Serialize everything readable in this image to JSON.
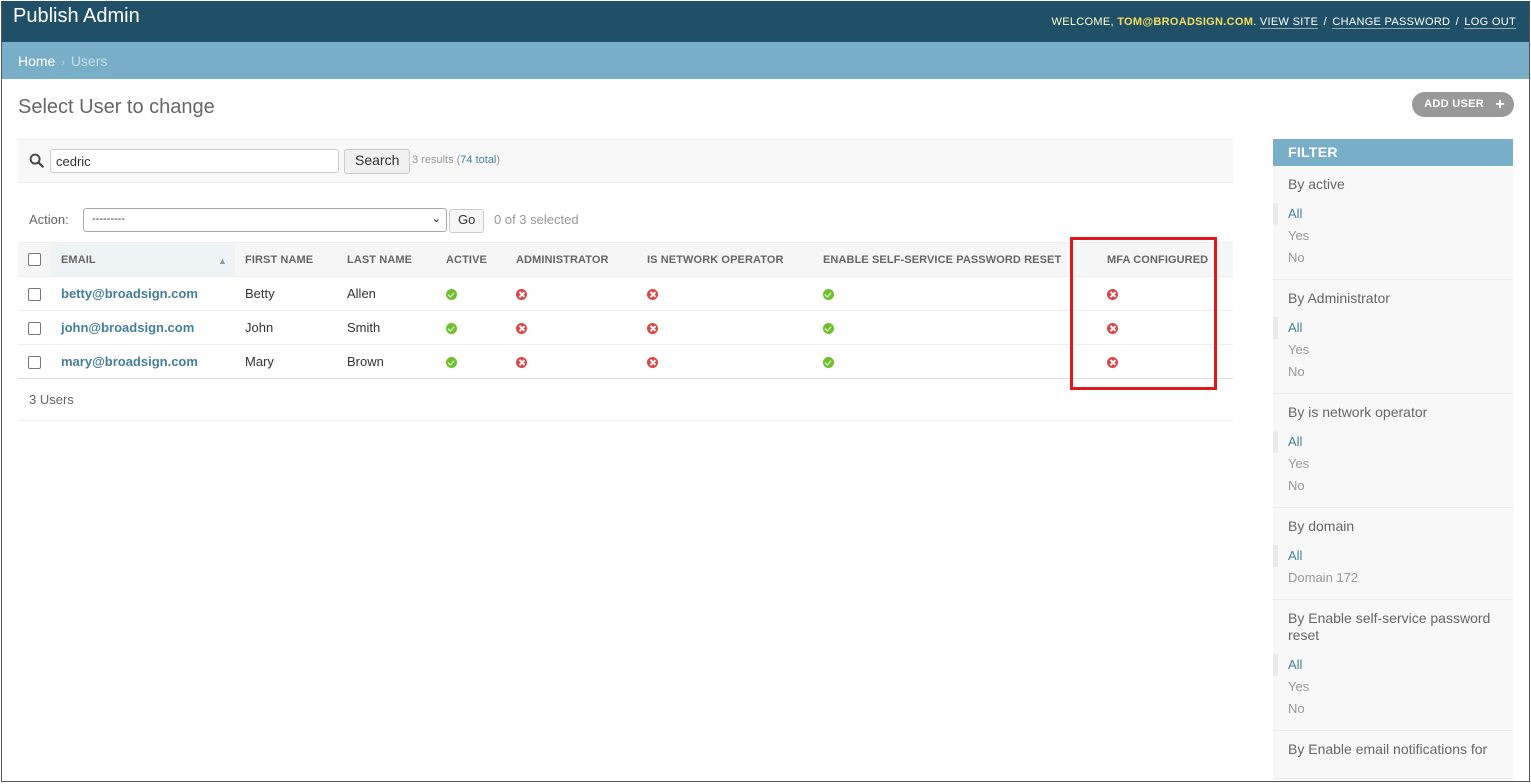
{
  "header": {
    "brand": "Publish Admin",
    "welcome": "Welcome,",
    "user": "tom@broadsign.com",
    "view_site": "View site",
    "change_password": "Change password",
    "log_out": "Log out"
  },
  "breadcrumbs": {
    "home": "Home",
    "sep": "›",
    "current": "Users"
  },
  "page": {
    "title": "Select User to change",
    "add_user": "Add User"
  },
  "search": {
    "value": "cedric",
    "button": "Search",
    "results": "3 results (",
    "total": "74 total",
    "results_end": ")"
  },
  "actions": {
    "label": "Action:",
    "selected_value": "---------",
    "go": "Go",
    "counter": "0 of 3 selected"
  },
  "table": {
    "columns": [
      "Email",
      "First name",
      "Last name",
      "Active",
      "Administrator",
      "Is network operator",
      "Enable self-service password reset",
      "MFA configured"
    ],
    "rows": [
      {
        "email": "betty@broadsign.com",
        "first": "Betty",
        "last": "Allen",
        "active": true,
        "admin": false,
        "operator": false,
        "reset": true,
        "mfa": false
      },
      {
        "email": "john@broadsign.com",
        "first": "John",
        "last": "Smith",
        "active": true,
        "admin": false,
        "operator": false,
        "reset": true,
        "mfa": false
      },
      {
        "email": "mary@broadsign.com",
        "first": "Mary",
        "last": "Brown",
        "active": true,
        "admin": false,
        "operator": false,
        "reset": true,
        "mfa": false
      }
    ],
    "count": "3 Users"
  },
  "filter": {
    "title": "Filter",
    "groups": [
      {
        "title": "By active",
        "options": [
          "All",
          "Yes",
          "No"
        ]
      },
      {
        "title": "By Administrator",
        "options": [
          "All",
          "Yes",
          "No"
        ]
      },
      {
        "title": "By is network operator",
        "options": [
          "All",
          "Yes",
          "No"
        ]
      },
      {
        "title": "By domain",
        "options": [
          "All",
          "Domain 172"
        ]
      },
      {
        "title": "By Enable self-service password reset",
        "options": [
          "All",
          "Yes",
          "No"
        ]
      },
      {
        "title": "By Enable email notifications for",
        "options": []
      }
    ]
  },
  "colors": {
    "header_bg": "#1f5068",
    "breadcrumb_bg": "#79aec8",
    "link": "#447e9b",
    "yes": "#70bf2b",
    "no": "#dd4646",
    "highlight": "#e2171c"
  }
}
